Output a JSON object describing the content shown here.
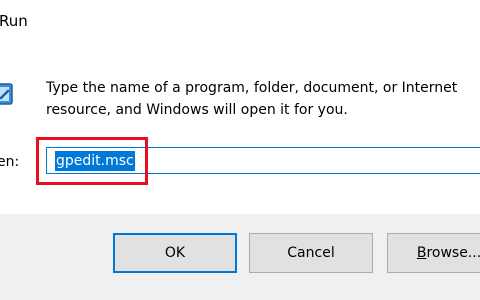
{
  "window": {
    "title": "Run"
  },
  "description": "Type the name of a program, folder, document, or Internet\nresource, and Windows will open it for you.",
  "open": {
    "label": "en:",
    "value": "gpedit.msc"
  },
  "buttons": {
    "ok": "OK",
    "cancel": "Cancel",
    "browse_first": "B",
    "browse_rest": "rowse..."
  },
  "icons": {
    "app_icon": "run-app-icon"
  },
  "colors": {
    "accent": "#0078d7",
    "highlight_box": "#e8101e",
    "footer_bg": "#f0f0f0"
  }
}
